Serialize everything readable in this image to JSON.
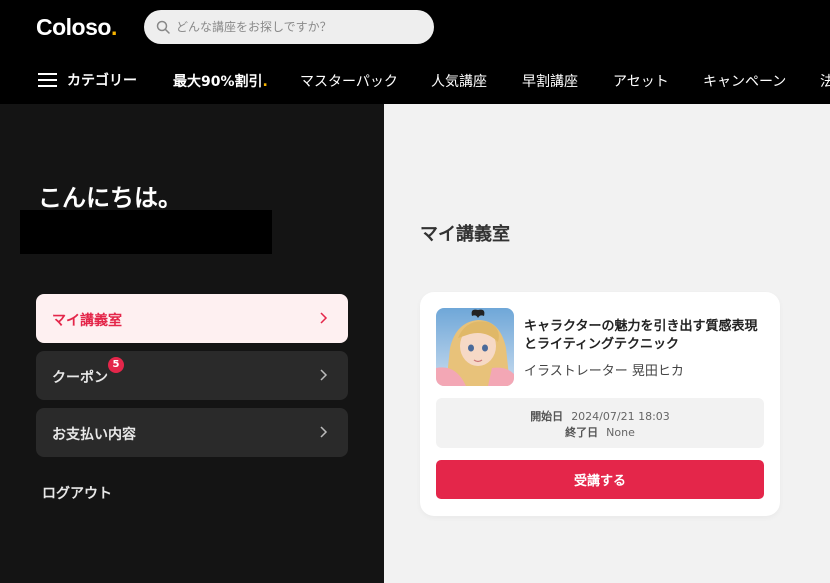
{
  "header": {
    "logo_text": "Coloso",
    "logo_dot": ".",
    "search_placeholder": "どんな講座をお探しですか？"
  },
  "nav": {
    "category_label": "カテゴリー",
    "items": [
      {
        "label": "最大90%割引",
        "accent": "."
      },
      {
        "label": "マスターパック"
      },
      {
        "label": "人気講座"
      },
      {
        "label": "早割講座"
      },
      {
        "label": "アセット"
      },
      {
        "label": "キャンペーン"
      },
      {
        "label": "法"
      }
    ]
  },
  "sidebar": {
    "greeting": "こんにちは。",
    "menu": [
      {
        "label": "マイ講義室",
        "active": true
      },
      {
        "label": "クーポン",
        "badge": "5"
      },
      {
        "label": "お支払い内容"
      }
    ],
    "logout_label": "ログアウト"
  },
  "main": {
    "title": "マイ講義室",
    "course": {
      "title": "キャラクターの魅力を引き出す質感表現とライティングテクニック",
      "instructor": "イラストレーター 晃田ヒカ",
      "start_label": "開始日",
      "start_value": "2024/07/21 18:03",
      "end_label": "終了日",
      "end_value": "None",
      "button_label": "受講する"
    }
  },
  "colors": {
    "accent": "#e4264a",
    "brand_dot": "#f8b400",
    "sidebar_bg": "#141414",
    "content_bg": "#f2f2f2"
  },
  "icons": [
    "search-icon",
    "hamburger-icon",
    "chevron-right-icon"
  ]
}
